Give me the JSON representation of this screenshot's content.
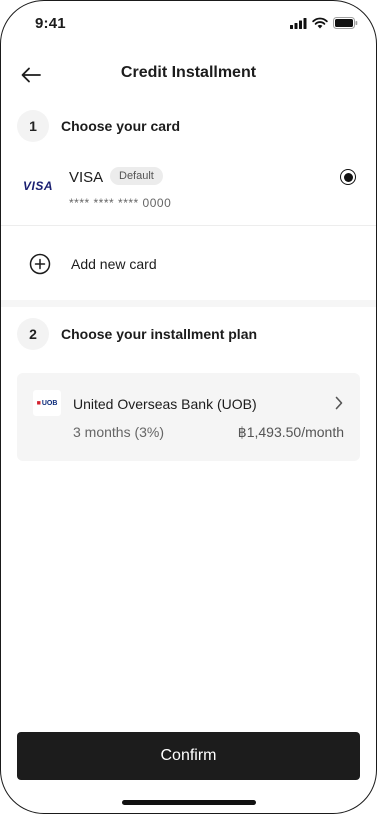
{
  "status_bar": {
    "time": "9:41",
    "icons": [
      "signal-icon",
      "wifi-icon",
      "battery-icon"
    ]
  },
  "header": {
    "title": "Credit Installment",
    "back_icon": "arrow-left-icon"
  },
  "step1": {
    "number": "1",
    "title": "Choose your card"
  },
  "card": {
    "brand_logo": "VISA",
    "name": "VISA",
    "badge": "Default",
    "number": "**** **** **** 0000",
    "selected": true
  },
  "add_card": {
    "icon": "plus-circle-icon",
    "label": "Add new card"
  },
  "step2": {
    "number": "2",
    "title": "Choose your installment plan"
  },
  "plan": {
    "bank_logo": "UOB",
    "bank_name": "United Overseas Bank (UOB)",
    "term": "3 months (3%)",
    "amount": "฿1,493.50/month",
    "chevron_icon": "chevron-right-icon"
  },
  "footer": {
    "confirm_label": "Confirm"
  },
  "colors": {
    "primary": "#1c1c1c",
    "surface": "#f5f5f5",
    "visa_blue": "#1a1f71",
    "uob_red": "#d3202d",
    "uob_navy": "#0b2a7a"
  }
}
